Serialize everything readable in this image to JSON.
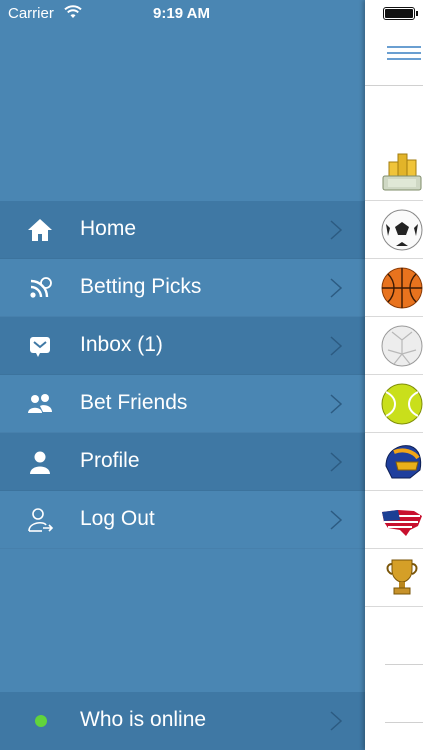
{
  "status_bar": {
    "carrier": "Carrier",
    "time": "9:19 AM"
  },
  "menu": {
    "items": [
      {
        "label": "Home",
        "icon": "home-icon"
      },
      {
        "label": "Betting Picks",
        "icon": "picks-icon"
      },
      {
        "label": "Inbox (1)",
        "icon": "inbox-icon"
      },
      {
        "label": "Bet Friends",
        "icon": "friends-icon"
      },
      {
        "label": "Profile",
        "icon": "profile-icon"
      },
      {
        "label": "Log Out",
        "icon": "logout-icon"
      }
    ]
  },
  "online": {
    "label": "Who is online",
    "status_color": "#61d43b"
  },
  "colors": {
    "menu_bg": "#4a86b3",
    "menu_row_dark": "#3f78a4",
    "accent": "#6a9fd1"
  },
  "sports_icons": [
    "coins-icon",
    "soccer-ball-icon",
    "basketball-icon",
    "handball-icon",
    "tennis-ball-icon",
    "racing-helmet-icon",
    "usa-flag-icon",
    "trophy-icon"
  ]
}
